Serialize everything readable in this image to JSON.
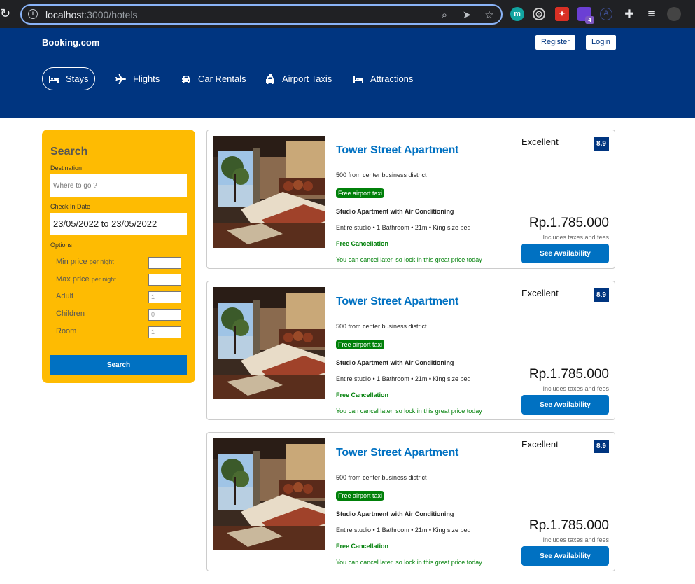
{
  "browser": {
    "url_host": "localhost",
    "url_path": ":3000/hotels",
    "extension_badge": "4"
  },
  "header": {
    "logo": "Booking.com",
    "register_label": "Register",
    "login_label": "Login",
    "nav": [
      {
        "label": "Stays",
        "icon": "bed-icon",
        "active": true
      },
      {
        "label": "Flights",
        "icon": "plane-icon"
      },
      {
        "label": "Car Rentals",
        "icon": "car-icon"
      },
      {
        "label": "Airport Taxis",
        "icon": "taxi-icon"
      },
      {
        "label": "Attractions",
        "icon": "bed-icon"
      }
    ]
  },
  "search": {
    "title": "Search",
    "destination_label": "Destination",
    "destination_placeholder": "Where to go ?",
    "checkin_label": "Check In Date",
    "checkin_value": "23/05/2022 to 23/05/2022",
    "options_label": "Options",
    "options": [
      {
        "label": "Min price",
        "suffix": "per night",
        "value": ""
      },
      {
        "label": "Max price",
        "suffix": "per night",
        "value": ""
      },
      {
        "label": "Adult",
        "suffix": "",
        "value": "1"
      },
      {
        "label": "Children",
        "suffix": "",
        "value": "0"
      },
      {
        "label": "Room",
        "suffix": "",
        "value": "1"
      }
    ],
    "button_label": "Search"
  },
  "results": [
    {
      "title": "Tower Street Apartment",
      "distance": "500 from center business district",
      "taxi": "Free airport taxi",
      "subtitle": "Studio Apartment with Air Conditioning",
      "features": "Entire studio • 1 Bathroom • 21m • King size bed",
      "cancel": "Free Cancellation",
      "cancel_sub": "You can cancel later, so lock in this great price today",
      "rating_text": "Excellent",
      "rating": "8.9",
      "price": "Rp.1.785.000",
      "tax": "Includes taxes and fees",
      "button": "See Availability"
    },
    {
      "title": "Tower Street Apartment",
      "distance": "500 from center business district",
      "taxi": "Free airport taxi",
      "subtitle": "Studio Apartment with Air Conditioning",
      "features": "Entire studio • 1 Bathroom • 21m • King size bed",
      "cancel": "Free Cancellation",
      "cancel_sub": "You can cancel later, so lock in this great price today",
      "rating_text": "Excellent",
      "rating": "8.9",
      "price": "Rp.1.785.000",
      "tax": "Includes taxes and fees",
      "button": "See Availability"
    },
    {
      "title": "Tower Street Apartment",
      "distance": "500 from center business district",
      "taxi": "Free airport taxi",
      "subtitle": "Studio Apartment with Air Conditioning",
      "features": "Entire studio • 1 Bathroom • 21m • King size bed",
      "cancel": "Free Cancellation",
      "cancel_sub": "You can cancel later, so lock in this great price today",
      "rating_text": "Excellent",
      "rating": "8.9",
      "price": "Rp.1.785.000",
      "tax": "Includes taxes and fees",
      "button": "See Availability"
    }
  ],
  "colors": {
    "brand_blue": "#003580",
    "accent_blue": "#0071c2",
    "search_yellow": "#febb02",
    "success_green": "#008009"
  }
}
